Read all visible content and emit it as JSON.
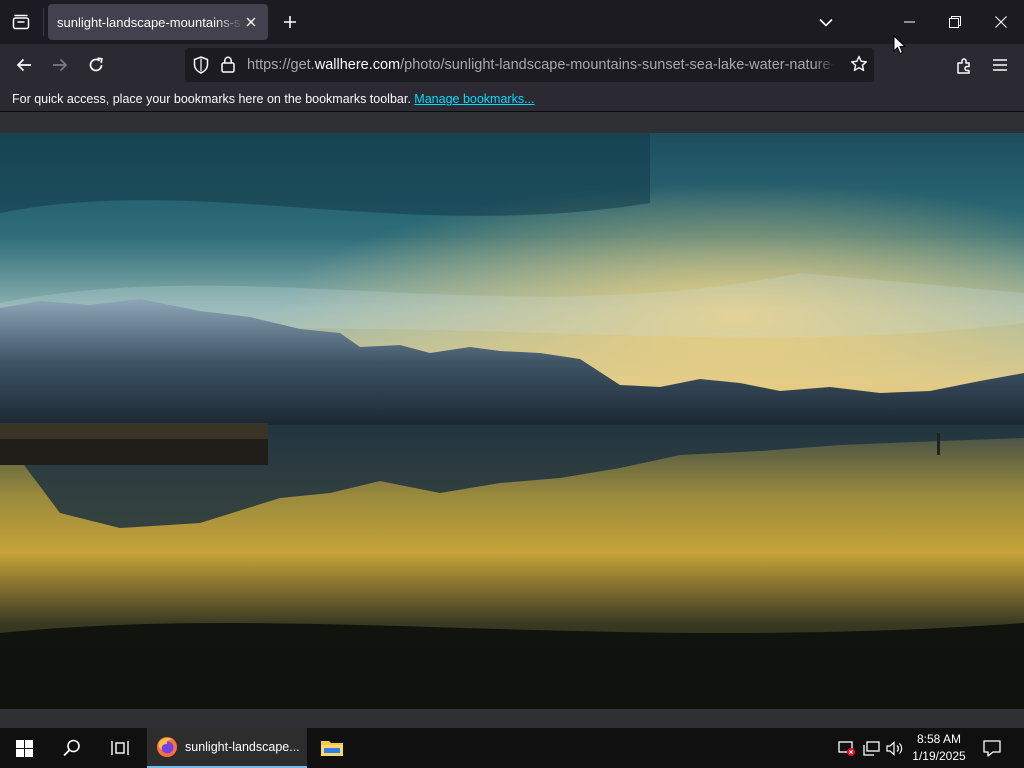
{
  "tab": {
    "title": "sunlight-landscape-mountains-sunset-sea-lake-water-nature-reflection"
  },
  "navbar": {
    "url_prefix": "https://get.",
    "url_host": "wallhere.com",
    "url_path": "/photo/sunlight-landscape-mountains-sunset-sea-lake-water-nature-reflection"
  },
  "bookmarks_bar": {
    "message": "For quick access, place your bookmarks here on the bookmarks toolbar.",
    "link": "Manage bookmarks..."
  },
  "taskbar": {
    "firefox_label": "sunlight-landscape...",
    "time": "8:58 AM",
    "date": "1/19/2025"
  },
  "colors": {
    "tab_strip": "#1c1b22",
    "toolbar": "#2b2a33",
    "active_tab": "#42414d",
    "link": "#00ddff",
    "taskbar": "#101010"
  },
  "icons": [
    "firefox-view-icon",
    "close-icon",
    "plus-icon",
    "chevron-down-icon",
    "minimize-icon",
    "maximize-icon",
    "back-arrow-icon",
    "forward-arrow-icon",
    "reload-icon",
    "shield-icon",
    "lock-icon",
    "star-icon",
    "extensions-icon",
    "menu-icon",
    "windows-start-icon",
    "search-icon",
    "task-view-icon",
    "firefox-icon",
    "file-explorer-icon",
    "security-alert-icon",
    "network-icon",
    "volume-icon",
    "notifications-icon"
  ]
}
